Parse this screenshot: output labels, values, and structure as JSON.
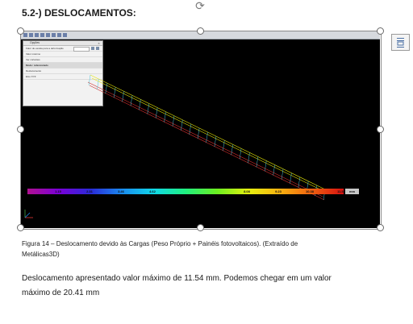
{
  "heading": "5.2-) DESLOCAMENTOS:",
  "figure": {
    "legend": {
      "labels": [
        "1.15",
        "2.31",
        "3.46",
        "4.62",
        "",
        "",
        "8.08",
        "9.23",
        "10.38",
        "11.54"
      ],
      "unit": "mm"
    },
    "colors": {
      "background": "#000000",
      "beam_upper": "#e6e600",
      "beam_lower": "#cc2a2a",
      "verticals": "#4fc3d8"
    },
    "panel_title": "Opções",
    "panel_rows": [
      "Fator de escala para a deformação",
      "Valor máximo",
      "Ver cortantes",
      "Modo: referenciado",
      "Deslocamento",
      "Eixo XYZ"
    ]
  },
  "caption": "Figura 14 – Deslocamento devido às Cargas (Peso Próprio + Painéis fotovoltaicos). (Extraído de Metálicas3D)",
  "body_text": "Deslocamento apresentado valor máximo de 11.54 mm. Podemos chegar em um valor máximo de 20.41 mm"
}
